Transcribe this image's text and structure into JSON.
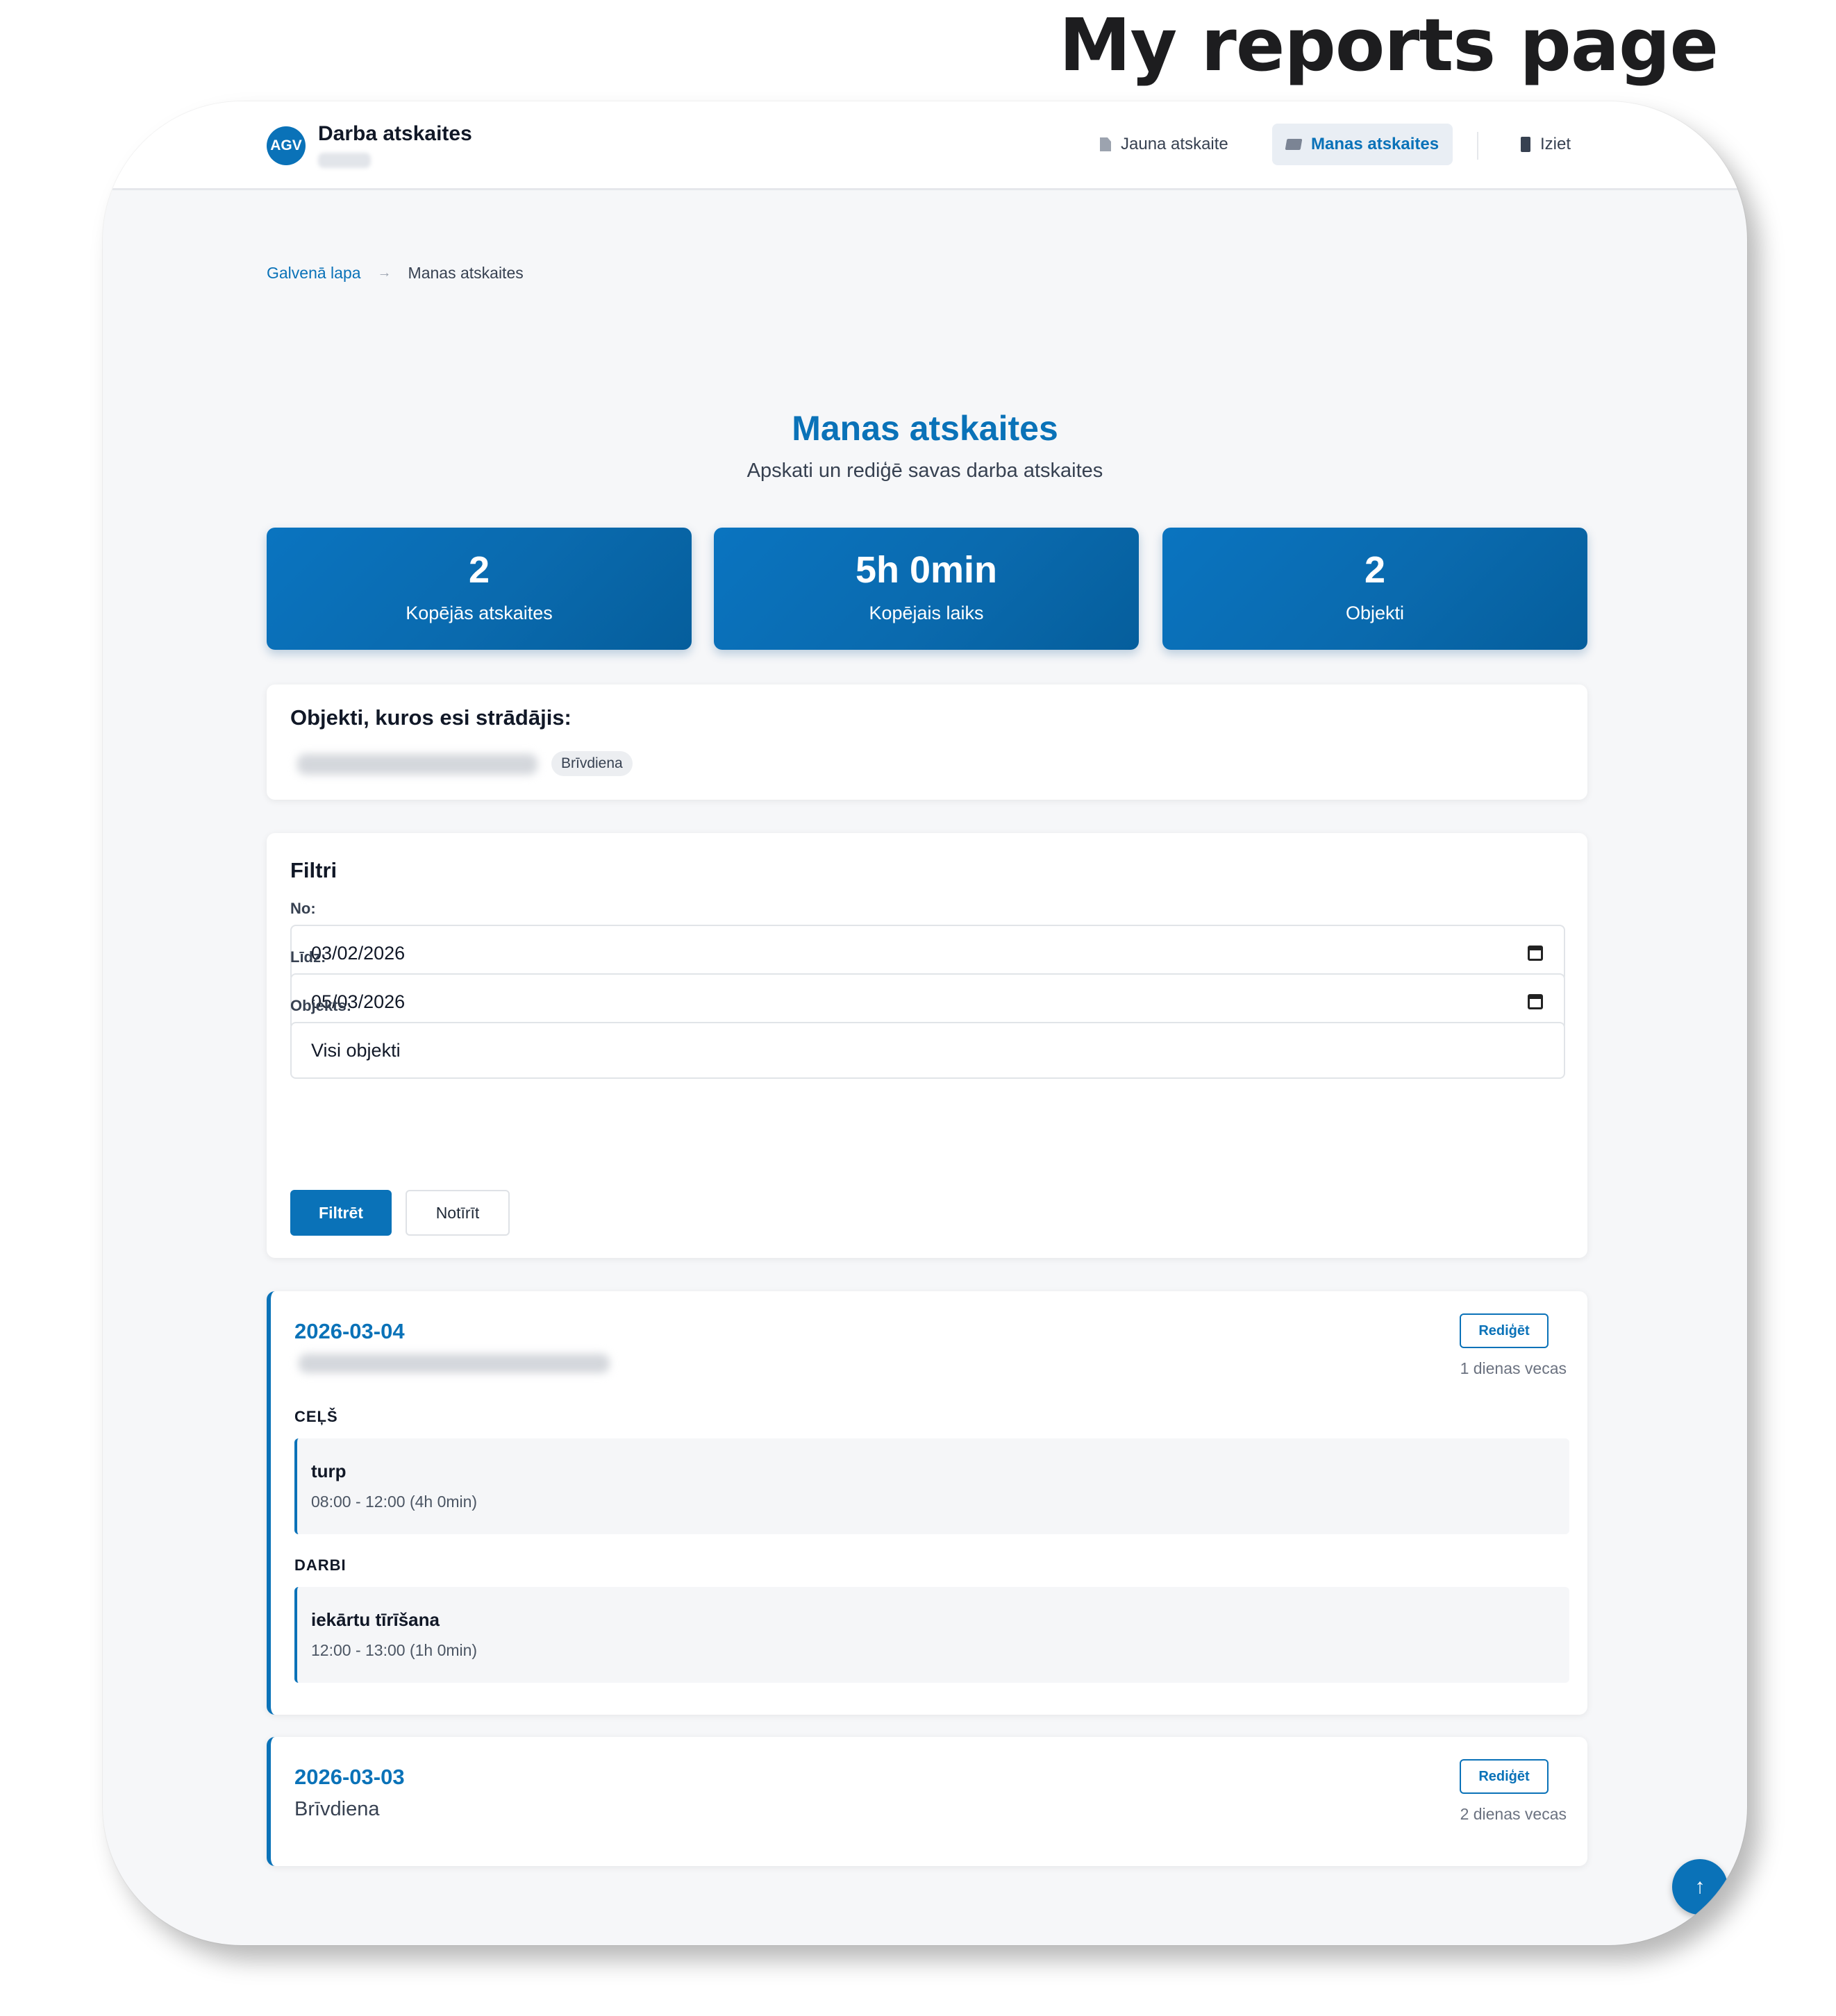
{
  "caption": "My reports page",
  "header": {
    "logo_text": "AGV",
    "app_title": "Darba atskaites",
    "nav": {
      "new_report": "Jauna atskaite",
      "my_reports": "Manas atskaites",
      "logout": "Iziet"
    },
    "icons": {
      "new_report": "document-icon",
      "my_reports": "folder-icon",
      "logout": "door-icon"
    }
  },
  "breadcrumb": {
    "home": "Galvenā lapa",
    "separator": "→",
    "current": "Manas atskaites"
  },
  "page": {
    "title": "Manas atskaites",
    "subtitle": "Apskati un rediģē savas darba atskaites"
  },
  "stats": [
    {
      "value": "2",
      "label": "Kopējās atskaites"
    },
    {
      "value": "5h 0min",
      "label": "Kopējais laiks"
    },
    {
      "value": "2",
      "label": "Objekti"
    }
  ],
  "objects": {
    "title": "Objekti, kuros esi strādājis:",
    "tags": [
      "Brīvdiena"
    ]
  },
  "filters": {
    "title": "Filtri",
    "from_label": "No:",
    "from_value": "03/02/2026",
    "to_label": "Līdz:",
    "to_value": "05/03/2026",
    "object_label": "Objekts:",
    "object_value": "Visi objekti",
    "filter_button": "Filtrēt",
    "clear_button": "Notīrīt"
  },
  "reports": [
    {
      "date": "2026-03-04",
      "edit_label": "Rediģēt",
      "age": "1 dienas vecas",
      "sections": [
        {
          "title": "CEĻŠ",
          "entries": [
            {
              "name": "turp",
              "time": "08:00 - 12:00 (4h 0min)"
            }
          ]
        },
        {
          "title": "DARBI",
          "entries": [
            {
              "name": "iekārtu tīrīšana",
              "time": "12:00 - 13:00 (1h 0min)"
            }
          ]
        }
      ]
    },
    {
      "date": "2026-03-03",
      "subtitle": "Brīvdiena",
      "edit_label": "Rediģēt",
      "age": "2 dienas vecas"
    }
  ],
  "scroll_top": "↑",
  "colors": {
    "accent": "#0a72b8",
    "background": "#f6f7f9"
  }
}
